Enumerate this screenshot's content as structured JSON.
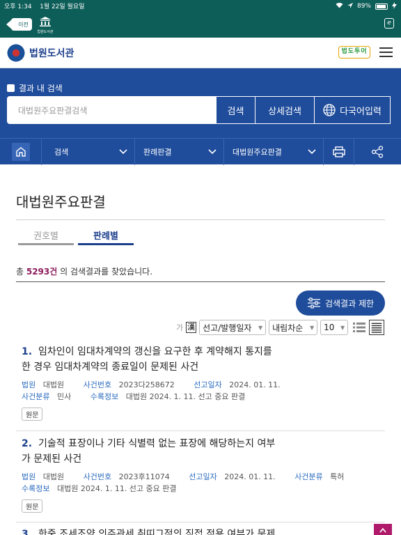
{
  "status": {
    "time": "오후 1:34",
    "date": "1월 22일 월요일",
    "battery": "89%"
  },
  "browser": {
    "back_label": "이전",
    "mini_lib_label": "법원도서관"
  },
  "site": {
    "name": "법원도서관",
    "kids_logo": "법도투어"
  },
  "search": {
    "in_result_label": "결과 내 검색",
    "placeholder": "대법원주요판결검색",
    "search_btn": "검색",
    "advanced_btn": "상세검색",
    "multilang_btn": "다국어입력"
  },
  "nav": {
    "seg1": "검색",
    "seg2": "판례판결",
    "seg3": "대법원주요판결"
  },
  "page": {
    "title": "대법원주요판결",
    "tabs": [
      "권호별",
      "판례별"
    ],
    "count_prefix": "총 ",
    "count_value": "5293건",
    "count_suffix": " 의 검색결과를 찾았습니다.",
    "filter_btn": "검색결과 제한"
  },
  "sort": {
    "ga": "가",
    "hanja": "漢",
    "order_by": "선고/발행일자",
    "direction": "내림차순",
    "page_size": "10"
  },
  "results": [
    {
      "no": "1.",
      "title_line1": "임차인이 임대차계약의 갱신을 요구한 후 계약해지 통지를",
      "title_line2": "한 경우 임대차계약의 종료일이 문제된 사건",
      "court_k": "법원",
      "court_v": "대법원",
      "case_k": "사건번호",
      "case_v": "2023다258672",
      "date_k": "선고일자",
      "date_v": "2024. 01. 11.",
      "type_k": "사건분류",
      "type_v": "민사",
      "rec_k": "수록정보",
      "rec_v": "대법원 2024. 1. 11. 선고 중요 판결",
      "orig": "원문"
    },
    {
      "no": "2.",
      "title_line1": "기술적 표장이나 기타 식별력 없는 표장에 해당하는지 여부",
      "title_line2": "가 문제된 사건",
      "court_k": "법원",
      "court_v": "대법원",
      "case_k": "사건번호",
      "case_v": "2023후11074",
      "date_k": "선고일자",
      "date_v": "2024. 01. 11.",
      "type_k": "사건분류",
      "type_v": "특허",
      "rec_k": "수록정보",
      "rec_v": "대법원 2024. 1. 11. 선고 중요 판결",
      "orig": "원문"
    },
    {
      "no": "3.",
      "title_line1": "한중 조세조약 의주관세 취띠그적의 직접 적용 여부가 문제"
    }
  ],
  "colors": {
    "teal": "#0d5d58",
    "navy": "#1f4c9b",
    "accent": "#8b1a5c",
    "link": "#2a6bbf"
  }
}
